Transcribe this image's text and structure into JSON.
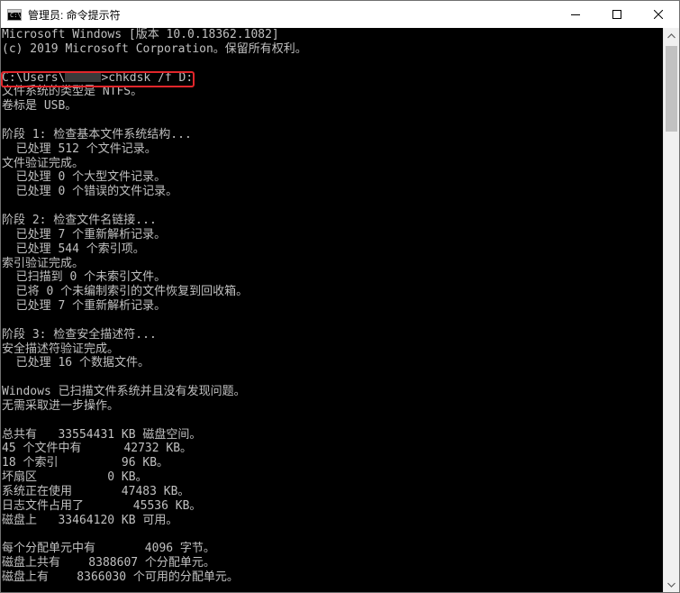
{
  "window": {
    "title": "管理员: 命令提示符",
    "icon": "cmd-icon",
    "icon_text": "C:\\"
  },
  "console": {
    "lines": [
      "Microsoft Windows [版本 10.0.18362.1082]",
      "(c) 2019 Microsoft Corporation。保留所有权利。",
      "",
      "C:\\Users\\",
      "文件系统的类型是 NTFS。",
      "卷标是 USB。",
      "",
      "阶段 1: 检查基本文件系统结构...",
      "  已处理 512 个文件记录。",
      "文件验证完成。",
      "  已处理 0 个大型文件记录。",
      "  已处理 0 个错误的文件记录。",
      "",
      "阶段 2: 检查文件名链接...",
      "  已处理 7 个重新解析记录。",
      "  已处理 544 个索引项。",
      "索引验证完成。",
      "  已扫描到 0 个未索引文件。",
      "  已将 0 个未编制索引的文件恢复到回收箱。",
      "  已处理 7 个重新解析记录。",
      "",
      "阶段 3: 检查安全描述符...",
      "安全描述符验证完成。",
      "  已处理 16 个数据文件。",
      "",
      "Windows 已扫描文件系统并且没有发现问题。",
      "无需采取进一步操作。",
      "",
      "总共有   33554431 KB 磁盘空间。",
      "45 个文件中有      42732 KB。",
      "18 个索引         96 KB。",
      "坏扇区          0 KB。",
      "系统正在使用       47483 KB。",
      "日志文件占用了       45536 KB。",
      "磁盘上   33464120 KB 可用。",
      "",
      "每个分配单元中有       4096 字节。",
      "磁盘上共有    8388607 个分配单元。",
      "磁盘上有    8366030 个可用的分配单元。"
    ],
    "command": ">chkdsk /f D:"
  },
  "colors": {
    "console_bg": "#000000",
    "console_text": "#c0c0c0",
    "highlight": "#e1262b"
  }
}
